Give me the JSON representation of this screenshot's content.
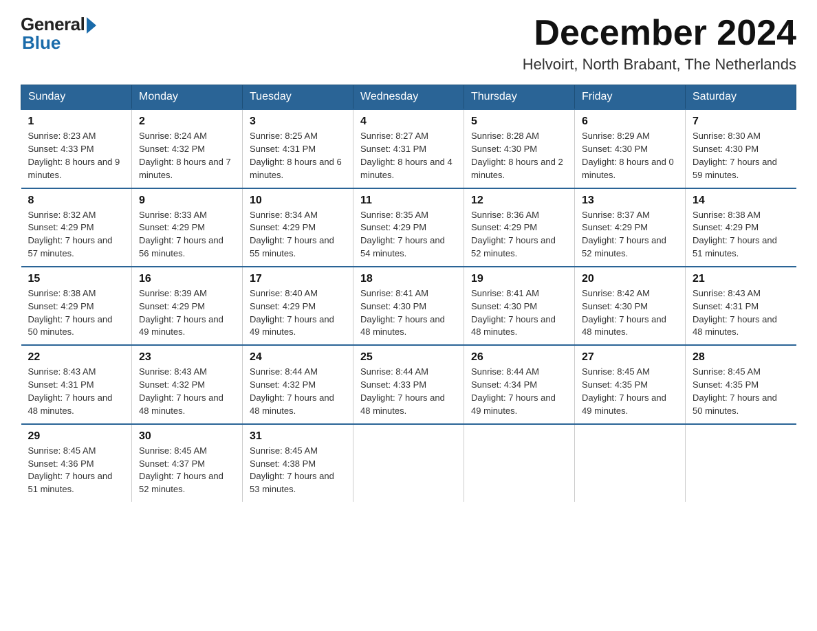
{
  "logo": {
    "general": "General",
    "blue": "Blue"
  },
  "title": "December 2024",
  "location": "Helvoirt, North Brabant, The Netherlands",
  "weekdays": [
    "Sunday",
    "Monday",
    "Tuesday",
    "Wednesday",
    "Thursday",
    "Friday",
    "Saturday"
  ],
  "weeks": [
    [
      {
        "day": "1",
        "sunrise": "8:23 AM",
        "sunset": "4:33 PM",
        "daylight": "8 hours and 9 minutes."
      },
      {
        "day": "2",
        "sunrise": "8:24 AM",
        "sunset": "4:32 PM",
        "daylight": "8 hours and 7 minutes."
      },
      {
        "day": "3",
        "sunrise": "8:25 AM",
        "sunset": "4:31 PM",
        "daylight": "8 hours and 6 minutes."
      },
      {
        "day": "4",
        "sunrise": "8:27 AM",
        "sunset": "4:31 PM",
        "daylight": "8 hours and 4 minutes."
      },
      {
        "day": "5",
        "sunrise": "8:28 AM",
        "sunset": "4:30 PM",
        "daylight": "8 hours and 2 minutes."
      },
      {
        "day": "6",
        "sunrise": "8:29 AM",
        "sunset": "4:30 PM",
        "daylight": "8 hours and 0 minutes."
      },
      {
        "day": "7",
        "sunrise": "8:30 AM",
        "sunset": "4:30 PM",
        "daylight": "7 hours and 59 minutes."
      }
    ],
    [
      {
        "day": "8",
        "sunrise": "8:32 AM",
        "sunset": "4:29 PM",
        "daylight": "7 hours and 57 minutes."
      },
      {
        "day": "9",
        "sunrise": "8:33 AM",
        "sunset": "4:29 PM",
        "daylight": "7 hours and 56 minutes."
      },
      {
        "day": "10",
        "sunrise": "8:34 AM",
        "sunset": "4:29 PM",
        "daylight": "7 hours and 55 minutes."
      },
      {
        "day": "11",
        "sunrise": "8:35 AM",
        "sunset": "4:29 PM",
        "daylight": "7 hours and 54 minutes."
      },
      {
        "day": "12",
        "sunrise": "8:36 AM",
        "sunset": "4:29 PM",
        "daylight": "7 hours and 52 minutes."
      },
      {
        "day": "13",
        "sunrise": "8:37 AM",
        "sunset": "4:29 PM",
        "daylight": "7 hours and 52 minutes."
      },
      {
        "day": "14",
        "sunrise": "8:38 AM",
        "sunset": "4:29 PM",
        "daylight": "7 hours and 51 minutes."
      }
    ],
    [
      {
        "day": "15",
        "sunrise": "8:38 AM",
        "sunset": "4:29 PM",
        "daylight": "7 hours and 50 minutes."
      },
      {
        "day": "16",
        "sunrise": "8:39 AM",
        "sunset": "4:29 PM",
        "daylight": "7 hours and 49 minutes."
      },
      {
        "day": "17",
        "sunrise": "8:40 AM",
        "sunset": "4:29 PM",
        "daylight": "7 hours and 49 minutes."
      },
      {
        "day": "18",
        "sunrise": "8:41 AM",
        "sunset": "4:30 PM",
        "daylight": "7 hours and 48 minutes."
      },
      {
        "day": "19",
        "sunrise": "8:41 AM",
        "sunset": "4:30 PM",
        "daylight": "7 hours and 48 minutes."
      },
      {
        "day": "20",
        "sunrise": "8:42 AM",
        "sunset": "4:30 PM",
        "daylight": "7 hours and 48 minutes."
      },
      {
        "day": "21",
        "sunrise": "8:43 AM",
        "sunset": "4:31 PM",
        "daylight": "7 hours and 48 minutes."
      }
    ],
    [
      {
        "day": "22",
        "sunrise": "8:43 AM",
        "sunset": "4:31 PM",
        "daylight": "7 hours and 48 minutes."
      },
      {
        "day": "23",
        "sunrise": "8:43 AM",
        "sunset": "4:32 PM",
        "daylight": "7 hours and 48 minutes."
      },
      {
        "day": "24",
        "sunrise": "8:44 AM",
        "sunset": "4:32 PM",
        "daylight": "7 hours and 48 minutes."
      },
      {
        "day": "25",
        "sunrise": "8:44 AM",
        "sunset": "4:33 PM",
        "daylight": "7 hours and 48 minutes."
      },
      {
        "day": "26",
        "sunrise": "8:44 AM",
        "sunset": "4:34 PM",
        "daylight": "7 hours and 49 minutes."
      },
      {
        "day": "27",
        "sunrise": "8:45 AM",
        "sunset": "4:35 PM",
        "daylight": "7 hours and 49 minutes."
      },
      {
        "day": "28",
        "sunrise": "8:45 AM",
        "sunset": "4:35 PM",
        "daylight": "7 hours and 50 minutes."
      }
    ],
    [
      {
        "day": "29",
        "sunrise": "8:45 AM",
        "sunset": "4:36 PM",
        "daylight": "7 hours and 51 minutes."
      },
      {
        "day": "30",
        "sunrise": "8:45 AM",
        "sunset": "4:37 PM",
        "daylight": "7 hours and 52 minutes."
      },
      {
        "day": "31",
        "sunrise": "8:45 AM",
        "sunset": "4:38 PM",
        "daylight": "7 hours and 53 minutes."
      },
      null,
      null,
      null,
      null
    ]
  ]
}
